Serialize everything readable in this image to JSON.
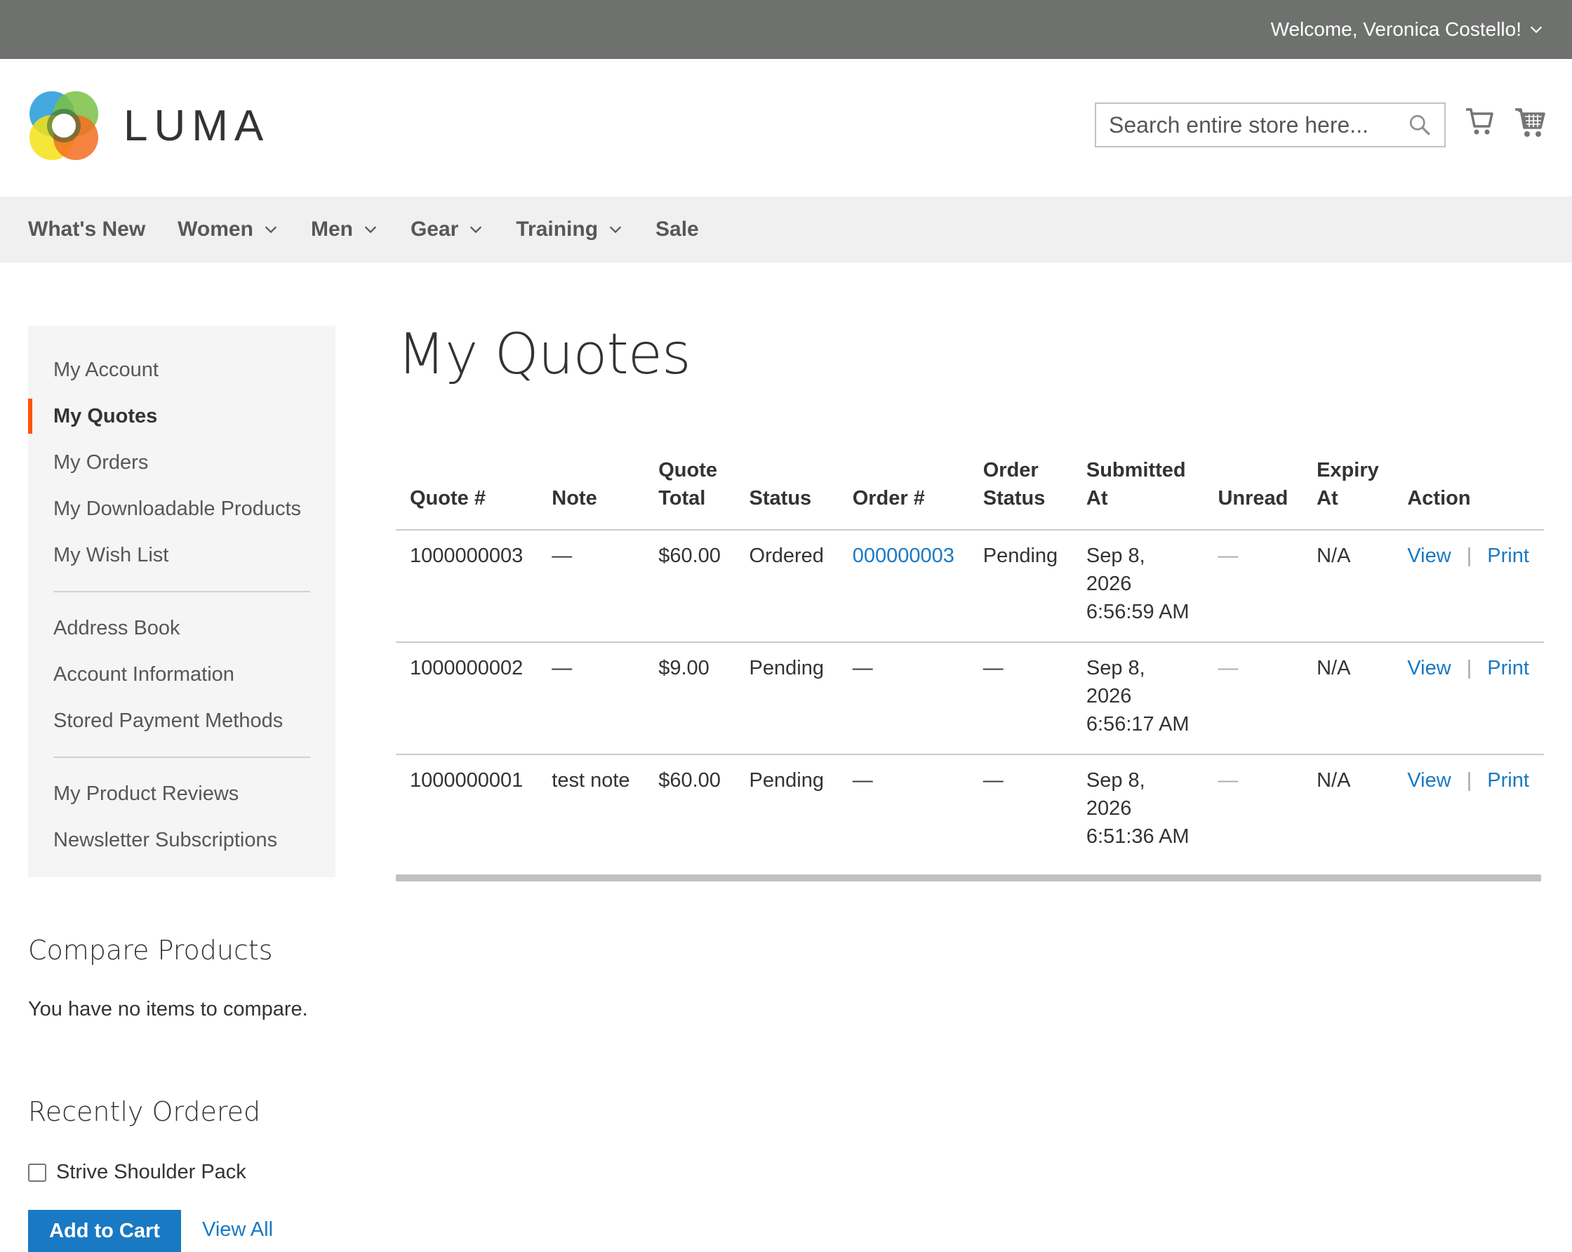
{
  "header": {
    "welcome": "Welcome, Veronica Costello!",
    "logo_text": "LUMA",
    "search_placeholder": "Search entire store here..."
  },
  "nav": {
    "items": [
      {
        "label": "What's New",
        "has_dropdown": false
      },
      {
        "label": "Women",
        "has_dropdown": true
      },
      {
        "label": "Men",
        "has_dropdown": true
      },
      {
        "label": "Gear",
        "has_dropdown": true
      },
      {
        "label": "Training",
        "has_dropdown": true
      },
      {
        "label": "Sale",
        "has_dropdown": false
      }
    ]
  },
  "sidebar": {
    "group1": [
      "My Account",
      "My Quotes",
      "My Orders",
      "My Downloadable Products",
      "My Wish List"
    ],
    "group2": [
      "Address Book",
      "Account Information",
      "Stored Payment Methods"
    ],
    "group3": [
      "My Product Reviews",
      "Newsletter Subscriptions"
    ],
    "active": "My Quotes"
  },
  "main": {
    "title": "My Quotes",
    "columns": [
      {
        "line1": "",
        "line2": "Quote #"
      },
      {
        "line1": "",
        "line2": "Note"
      },
      {
        "line1": "Quote",
        "line2": "Total"
      },
      {
        "line1": "",
        "line2": "Status"
      },
      {
        "line1": "",
        "line2": "Order #"
      },
      {
        "line1": "Order",
        "line2": "Status"
      },
      {
        "line1": "Submitted",
        "line2": "At"
      },
      {
        "line1": "",
        "line2": "Unread"
      },
      {
        "line1": "Expiry",
        "line2": "At"
      },
      {
        "line1": "",
        "line2": "Action"
      }
    ],
    "rows": [
      {
        "quote": "1000000003",
        "note": "—",
        "total": "$60.00",
        "status": "Ordered",
        "order": "000000003",
        "order_is_link": true,
        "order_status": "Pending",
        "submitted": [
          "Sep 8,",
          "2026",
          "6:56:59 AM"
        ],
        "unread": "—",
        "expiry": "N/A",
        "view": "View",
        "print": "Print"
      },
      {
        "quote": "1000000002",
        "note": "—",
        "total": "$9.00",
        "status": "Pending",
        "order": "—",
        "order_is_link": false,
        "order_status": "—",
        "submitted": [
          "Sep 8,",
          "2026",
          "6:56:17 AM"
        ],
        "unread": "—",
        "expiry": "N/A",
        "view": "View",
        "print": "Print"
      },
      {
        "quote": "1000000001",
        "note": "test note",
        "total": "$60.00",
        "status": "Pending",
        "order": "—",
        "order_is_link": false,
        "order_status": "—",
        "submitted": [
          "Sep 8,",
          "2026",
          "6:51:36 AM"
        ],
        "unread": "—",
        "expiry": "N/A",
        "view": "View",
        "print": "Print"
      }
    ],
    "action_separator": "|"
  },
  "compare": {
    "title": "Compare Products",
    "empty_text": "You have no items to compare."
  },
  "recently_ordered": {
    "title": "Recently Ordered",
    "item": "Strive Shoulder Pack",
    "add_to_cart": "Add to Cart",
    "view_all": "View All"
  },
  "colors": {
    "accent": "#ff5501",
    "link": "#1979c3",
    "topbar": "#6e716e"
  }
}
